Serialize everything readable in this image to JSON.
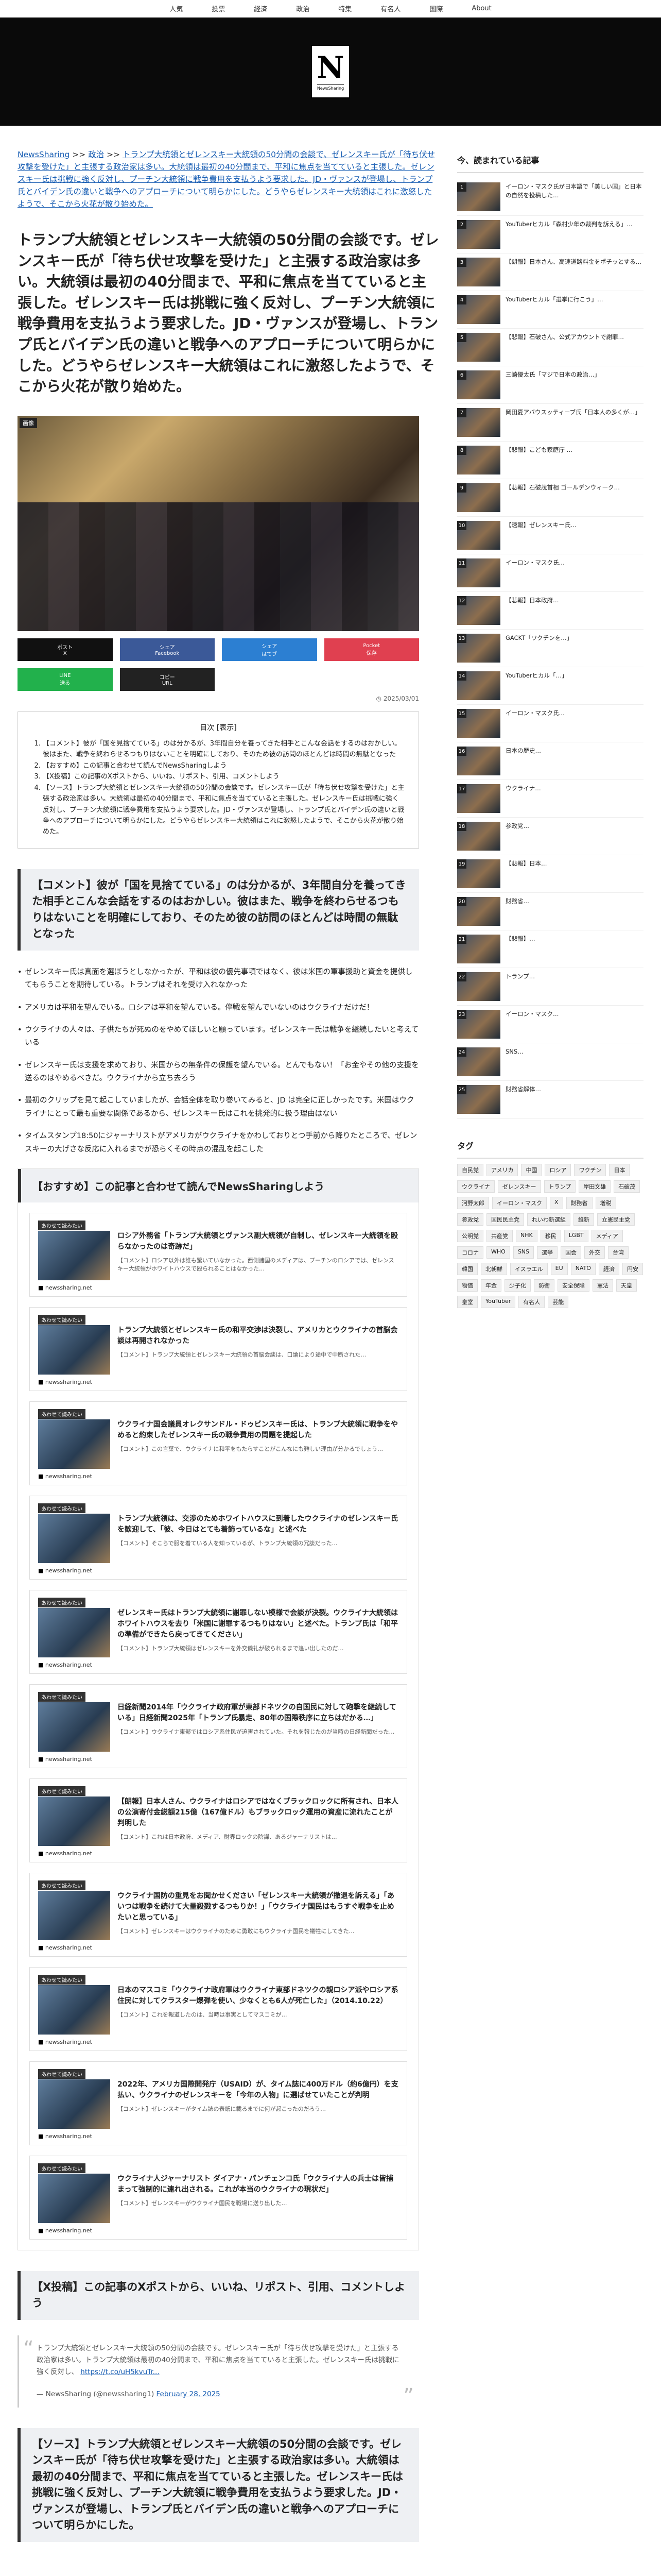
{
  "nav": [
    "人気",
    "投票",
    "経済",
    "政治",
    "特集",
    "有名人",
    "国際",
    "About"
  ],
  "logo": {
    "letter": "N",
    "tagline": "NewsSharing"
  },
  "breadcrumb": {
    "home": "NewsSharing",
    "sep": " >> ",
    "cat": "政治",
    "rest": "トランプ大統領とゼレンスキー大統領の50分間の会談で、ゼレンスキー氏が「待ち伏せ攻撃を受けた」と主張する政治家は多い。大統領は最初の40分間まで、平和に焦点を当てていると主張した。ゼレンスキー氏は挑戦に強く反対し、プーチン大統領に戦争費用を支払うよう要求した。JD・ヴァンスが登場し、トランプ氏とバイデン氏の違いと戦争へのアプローチについて明らかにした。どうやらゼレンスキー大統領はこれに激怒したようで、そこから火花が散り始めた。"
  },
  "article": {
    "title": "トランプ大統領とゼレンスキー大統領の50分間の会談です。ゼレンスキー氏が「待ち伏せ攻撃を受けた」と主張する政治家は多い。大統領は最初の40分間まで、平和に焦点を当てていると主張した。ゼレンスキー氏は挑戦に強く反対し、プーチン大統領に戦争費用を支払うよう要求した。JD・ヴァンスが登場し、トランプ氏とバイデン氏の違いと戦争へのアプローチについて明らかにした。どうやらゼレンスキー大統領はこれに激怒したようで、そこから火花が散り始めた。",
    "photo_badge": "画像",
    "date": "2025/03/01"
  },
  "share": [
    {
      "label": "ポスト",
      "sub": "X",
      "color": "#111111"
    },
    {
      "label": "シェア",
      "sub": "Facebook",
      "color": "#3b5998"
    },
    {
      "label": "シェア",
      "sub": "はてブ",
      "color": "#2c7fd2"
    },
    {
      "label": "Pocket",
      "sub": "保存",
      "color": "#e04050"
    },
    {
      "label": "LINE",
      "sub": "送る",
      "color": "#22b14c"
    },
    {
      "label": "コピー",
      "sub": "URL",
      "color": "#222222"
    }
  ],
  "toc": {
    "title": "目次 [表示]",
    "items": [
      "【コメント】彼が「国を見捨てている」のは分かるが、3年間自分を養ってきた相手とこんな会話をするのはおかしい。彼はまた、戦争を終わらせるつもりはないことを明確にしており、そのため彼の訪問のほとんどは時間の無駄となった",
      "【おすすめ】この記事と合わせて読んでNewsSharingしよう",
      "【X投稿】この記事のXポストから、いいね、リポスト、引用、コメントしよう",
      "【ソース】トランプ大統領とゼレンスキー大統領の50分間の会談です。ゼレンスキー氏が「待ち伏せ攻撃を受けた」と主張する政治家は多い。大統領は最初の40分間まで、平和に焦点を当てていると主張した。ゼレンスキー氏は挑戦に強く反対し、プーチン大統領に戦争費用を支払うよう要求した。JD・ヴァンスが登場し、トランプ氏とバイデン氏の違いと戦争へのアプローチについて明らかにした。どうやらゼレンスキー大統領はこれに激怒したようで、そこから火花が散り始めた。"
    ]
  },
  "comment_heading": "【コメント】彼が「国を見捨てている」のは分かるが、3年間自分を養ってきた相手とこんな会話をするのはおかしい。彼はまた、戦争を終わらせるつもりはないことを明確にしており、そのため彼の訪問のほとんどは時間の無駄となった",
  "comments": [
    "ゼレンスキー氏は真面を選ぼうとしなかったが、平和は彼の優先事項ではなく、彼は米国の軍事援助と資金を提供してもらうことを期待している。トランプはそれを受け入れなかった",
    "アメリカは平和を望んでいる。ロシアは平和を望んでいる。停戦を望んでいないのはウクライナだけだ！",
    "ウクライナの人々は、子供たちが死ぬのをやめてほしいと願っています。ゼレンスキー氏は戦争を継続したいと考えている",
    "ゼレンスキー氏は支援を求めており、米国からの無条件の保護を望んでいる。とんでもない！「お金やその他の支援を送るのはやめるべきだ。ウクライナから立ち去ろう",
    "最初のクリップを見て起こしていましたが、会話全体を取り巻いてみると、JD は完全に正しかったです。米国はウクライナにとって最も重要な関係であるから、ゼレンスキー氏はこれを挑発的に扱う理由はない",
    "タイムスタンプ18:50にジャーナリストがアメリカがウクライナをかわしておりとつ手前から降りたところで、ゼレンスキーの大げさな反応に入れるまでが恐らくその時点の混乱を起こした"
  ],
  "rec": {
    "heading": "【おすすめ】この記事と合わせて読んでNewsSharingしよう",
    "tag": "あわせて読みたい",
    "cards": [
      {
        "title": "ロシア外務省「トランプ大統領とヴァンス副大統領が自制し、ゼレンスキー大統領を殴らなかったのは奇跡だ」",
        "text": "【コメント】ロシア以外は誰も驚いていなかった。西側諸国のメディアは、プーチンのロシアでは、ゼレンスキー大統領がホワイトハウスで殴られることはなかった…",
        "src": "newssharing.net"
      },
      {
        "title": "トランプ大統領とゼレンスキー氏の和平交渉は決裂し、アメリカとウクライナの首脳会談は再開されなかった",
        "text": "【コメント】トランプ大統領とゼレンスキー大統領の首脳会談は、口論により途中で中断された…",
        "src": "newssharing.net"
      },
      {
        "title": "ウクライナ国会議員オレクサンドル・ドゥビンスキー氏は、トランプ大統領に戦争をやめると約束したゼレンスキー氏の戦争費用の問題を提起した",
        "text": "【コメント】この言葉で、ウクライナに和平をもたらすことがこんなにも難しい理由が分かるでしょう…",
        "src": "newssharing.net"
      },
      {
        "title": "トランプ大統領は、交渉のためホワイトハウスに到着したウクライナのゼレンスキー氏を歓迎して、「彼、今日はとても着飾っているな」と述べた",
        "text": "【コメント】そこらで服を着ている人を知っているが、トランプ大統領の冗談だった…",
        "src": "newssharing.net"
      },
      {
        "title": "ゼレンスキー氏はトランプ大統領に謝罪しない模様で会談が決裂。ウクライナ大統領はホワイトハウスを去り「米国に謝罪するつもりはない」と述べた。トランプ氏は「和平の準備ができたら戻ってきてください」",
        "text": "【コメント】トランプ大統領はゼレンスキーを外交儀礼が破られるまで追い出したのだ…",
        "src": "newssharing.net"
      },
      {
        "title": "日経新聞2014年「ウクライナ政府軍が東部ドネツクの自国民に対して砲撃を継続している」日経新聞2025年「トランプ氏暴走、80年の国際秩序に立ちはだかる…」",
        "text": "【コメント】ウクライナ東部ではロシア系住民が迫害されていた。それを報じたのが当時の日経新聞だった…",
        "src": "newssharing.net"
      },
      {
        "title": "【朗報】日本人さん、ウクライナはロシアではなくブラックロックに所有され、日本人の公演寄付金総額215億（167億ドル）もブラックロック運用の資産に流れたことが判明した",
        "text": "【コメント】これは日本政府、メディア、財界ロックの陰謀、あるジャーナリストは…",
        "src": "newssharing.net"
      },
      {
        "title": "ウクライナ国防の重見をお聞かせください「ゼレンスキー大統領が撤退を訴える」「あいつは戦争を続けて大量殺戮するつもりか！」「ウクライナ国民はもうすぐ戦争を止めたいと思っている」",
        "text": "【コメント】ゼレンスキーはウクライナのために勇敢にもウクライナ国民を犠牲にしてきた…",
        "src": "newssharing.net"
      },
      {
        "title": "日本のマスコミ「ウクライナ政府軍はウクライナ東部ドネツクの親ロシア派やロシア系住民に対してクラスター爆弾を使い、少なくとも6人が死亡した」（2014.10.22）",
        "text": "【コメント】これを報道したのは、当時は事実としてマスコミが…",
        "src": "newssharing.net"
      },
      {
        "title": "2022年、アメリカ国際開発庁（USAID）が、タイム誌に400万ドル（約6億円）を支払い、ウクライナのゼレンスキーを「今年の人物」に選ばせていたことが判明",
        "text": "【コメント】ゼレンスキーがタイム誌の表紙に載るまでに何が起こったのだろう…",
        "src": "newssharing.net"
      },
      {
        "title": "ウクライナ人ジャーナリスト ダイアナ・パンチェンコ氏「ウクライナ人の兵士は皆捕まって強制的に連れ出される。これが本当のウクライナの現状だ」",
        "text": "【コメント】ゼレンスキーがウクライナ国民を戦場に送り出した…",
        "src": "newssharing.net"
      }
    ]
  },
  "x_heading": "【X投稿】この記事のXポストから、いいね、リポスト、引用、コメントしよう",
  "tweet": {
    "text": "トランプ大統領とゼレンスキー大統領の50分間の会談です。ゼレンスキー氏が「待ち伏せ攻撃を受けた」と主張する政治家は多い。トランプ大統領は最初の40分間まで、平和に焦点を当てていると主張した。ゼレンスキー氏は挑戦に強く反対し、",
    "link": "https://t.co/uH5kvuTr...",
    "author": "— NewsSharing (@newssharing1)",
    "date": "February 28, 2025"
  },
  "source_heading": "【ソース】トランプ大統領とゼレンスキー大統領の50分間の会談です。ゼレンスキー氏が「待ち伏せ攻撃を受けた」と主張する政治家は多い。大統領は最初の40分間まで、平和に焦点を当てていると主張した。ゼレンスキー氏は挑戦に強く反対し、プーチン大統領に戦争費用を支払うよう要求した。JD・ヴァンスが登場し、トランプ氏とバイデン氏の違いと戦争へのアプローチについて明らかにした。",
  "sidebar": {
    "ranking_title": "今、読まれている記事",
    "ranking": [
      "イーロン・マスク氏が日本語で「美しい国」と日本の自然を投稿した…",
      "YouTuberヒカル「森村少年の裁判を訴える」…",
      "【朗報】日本さん、高速道路料金をポチッとする…",
      "YouTuberヒカル「選挙に行こう」…",
      "【悲報】石破さん、公式アカウントで謝罪…",
      "三崎優太氏「マジで日本の政治…」",
      "岡田夏アバウスッティーブ氏「日本人の多くが…」",
      "【悲報】こども家庭庁 …",
      "【悲報】石破茂首相 ゴールデンウィーク…",
      "【速報】ゼレンスキー氏…",
      "イーロン・マスク氏…",
      "【悲報】日本政府…",
      "GACKT「ワクチンを…」",
      "YouTuberヒカル「…」",
      "イーロン・マスク氏…",
      "日本の歴史…",
      "ウクライナ…",
      "参政党…",
      "【悲報】日本…",
      "財務省…",
      "【悲報】…",
      "トランプ…",
      "イーロン・マスク…",
      "SNS…",
      "財務省解体…"
    ],
    "tags_title": "タグ",
    "tags": [
      "自民党",
      "アメリカ",
      "中国",
      "ロシア",
      "ワクチン",
      "日本",
      "ウクライナ",
      "ゼレンスキー",
      "トランプ",
      "岸田文雄",
      "石破茂",
      "河野太郎",
      "イーロン・マスク",
      "X",
      "財務省",
      "増税",
      "参政党",
      "国民民主党",
      "れいわ新選組",
      "維新",
      "立憲民主党",
      "公明党",
      "共産党",
      "NHK",
      "移民",
      "LGBT",
      "メディア",
      "コロナ",
      "WHO",
      "SNS",
      "選挙",
      "国会",
      "外交",
      "台湾",
      "韓国",
      "北朝鮮",
      "イスラエル",
      "EU",
      "NATO",
      "経済",
      "円安",
      "物価",
      "年金",
      "少子化",
      "防衛",
      "安全保障",
      "憲法",
      "天皇",
      "皇室",
      "YouTuber",
      "有名人",
      "芸能"
    ]
  }
}
